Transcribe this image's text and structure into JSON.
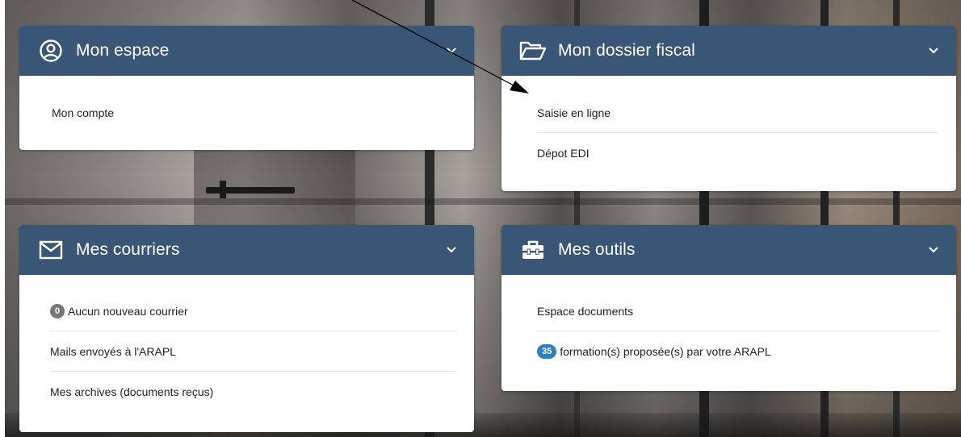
{
  "cards": {
    "espace": {
      "title": "Mon espace",
      "icon": "user-circle-icon",
      "items": [
        "Mon compte"
      ]
    },
    "fiscal": {
      "title": "Mon dossier fiscal",
      "icon": "folder-open-icon",
      "items": [
        "Saisie en ligne",
        "Dépot EDI"
      ]
    },
    "courriers": {
      "title": "Mes courriers",
      "icon": "envelope-icon",
      "items": [
        {
          "badge": "0",
          "label": "Aucun nouveau courrier"
        },
        {
          "label": "Mails envoyés à l'ARAPL"
        },
        {
          "label": "Mes archives (documents reçus)"
        }
      ]
    },
    "outils": {
      "title": "Mes outils",
      "icon": "toolbox-icon",
      "items": [
        {
          "label": "Espace documents"
        },
        {
          "badge": "35",
          "label": "formation(s) proposée(s) par votre ARAPL"
        }
      ]
    }
  },
  "colors": {
    "header": "#3a5676",
    "badge_grey": "#777777",
    "badge_blue": "#2f7fc1"
  }
}
